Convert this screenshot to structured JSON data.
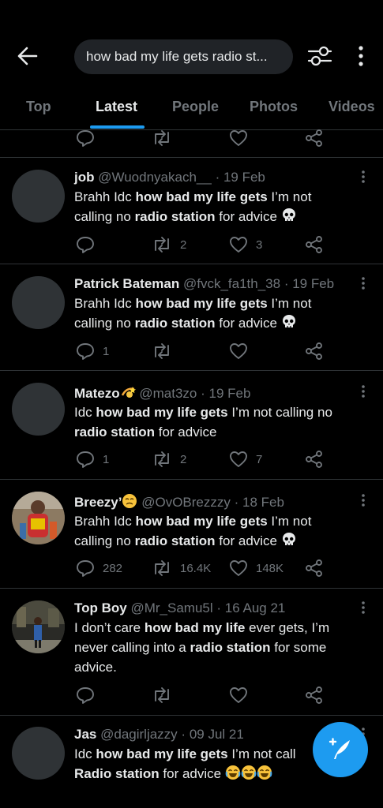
{
  "search": {
    "query": "how bad my life gets radio st..."
  },
  "tabs": [
    "Top",
    "Latest",
    "People",
    "Photos",
    "Videos"
  ],
  "colors": {
    "accent": "#1d9bf0",
    "muted": "#71767b",
    "divider": "#2f3336",
    "text": "#e7e9ea"
  },
  "tweets": [
    {
      "name": "job",
      "handle": "@Wuodnyakach__",
      "date": "19 Feb",
      "line1": [
        "Brahh Idc ",
        "how bad my life gets",
        " I’m not"
      ],
      "line2": [
        "calling no ",
        "radio station",
        " for advice"
      ],
      "emoji": "skull",
      "replies": "",
      "retweets": "2",
      "likes": "3"
    },
    {
      "name": "Patrick Bateman",
      "handle": "@fvck_fa1th_38",
      "date": "19 Feb",
      "line1": [
        "Brahh Idc ",
        "how bad my life gets",
        " I’m not"
      ],
      "line2": [
        "calling no ",
        "radio station",
        " for advice"
      ],
      "emoji": "skull",
      "replies": "1",
      "retweets": "",
      "likes": ""
    },
    {
      "name": "Matezo",
      "handle": "@mat3zo",
      "date": "19 Feb",
      "line1": [
        "Idc ",
        "how bad my life gets",
        " I’m not calling no"
      ],
      "line2": [
        "",
        "radio station",
        " for advice"
      ],
      "replies": "1",
      "retweets": "2",
      "likes": "7"
    },
    {
      "name": "Breezy’",
      "handle": "@OvOBrezzzy",
      "date": "18 Feb",
      "line1": [
        "Brahh Idc ",
        "how bad my life gets",
        " I’m not"
      ],
      "line2": [
        "calling no ",
        "radio station",
        " for advice"
      ],
      "emoji": "skull",
      "replies": "282",
      "retweets": "16.4K",
      "likes": "148K"
    },
    {
      "name": "Top Boy",
      "handle": "@Mr_Samu5l",
      "date": "16 Aug 21",
      "line1": [
        "I don’t care ",
        "how bad my life",
        " ever gets, I’m"
      ],
      "line2": [
        "never calling into a ",
        "radio station",
        " for some"
      ],
      "line3": "advice.",
      "replies": "",
      "retweets": "",
      "likes": ""
    },
    {
      "name": "Jas",
      "handle": "@dagirljazzy",
      "date": "09 Jul 21",
      "line1": [
        "Idc ",
        "how bad my life gets",
        " I’m not call"
      ],
      "line2": [
        "",
        "Radio station",
        " for advice "
      ],
      "emoji": "joy3"
    }
  ]
}
